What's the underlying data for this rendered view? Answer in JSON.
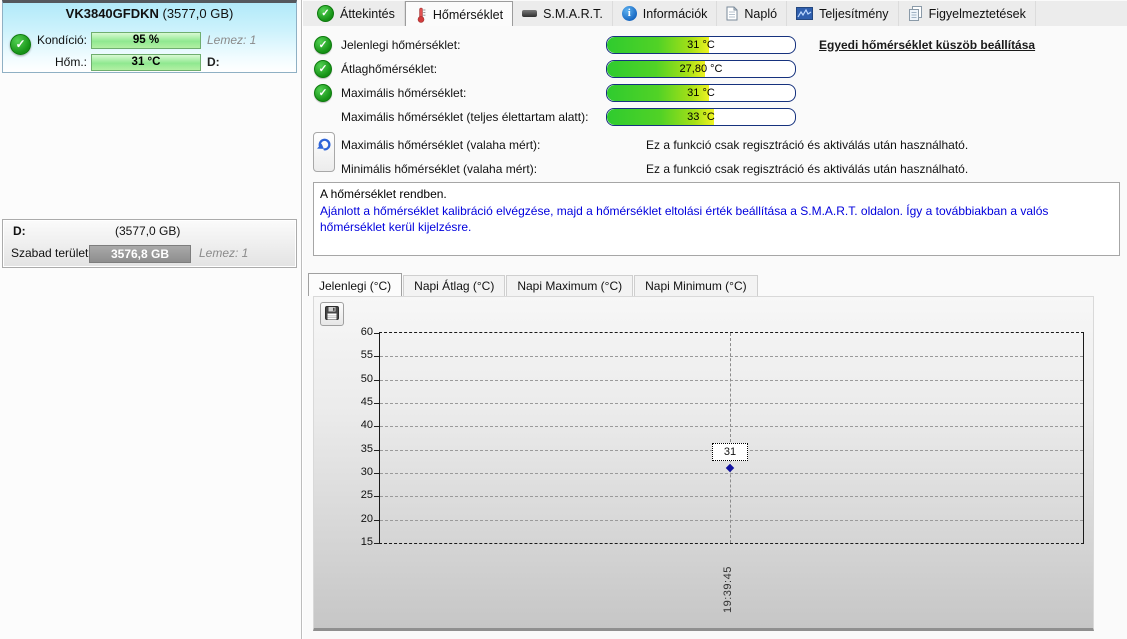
{
  "sidebar": {
    "drive": {
      "name": "VK3840GFDKN",
      "size": "(3577,0 GB)",
      "condition_label": "Kondíció:",
      "condition_value": "95 %",
      "lemez": "Lemez: 1",
      "temp_label": "Hőm.:",
      "temp_value": "31 °C",
      "letter": "D:",
      "status_icon": "green-check-circle"
    },
    "partition": {
      "name": "D:",
      "size": "(3577,0 GB)",
      "free_label": "Szabad terület",
      "free_value": "3576,8 GB",
      "lemez": "Lemez: 1"
    }
  },
  "tabs": [
    {
      "label": "Áttekintés",
      "icon": "green-check-icon"
    },
    {
      "label": "Hőmérséklet",
      "icon": "thermometer-icon",
      "active": true
    },
    {
      "label": "S.M.A.R.T.",
      "icon": "hard-disk-icon"
    },
    {
      "label": "Információk",
      "icon": "info-icon"
    },
    {
      "label": "Napló",
      "icon": "document-icon"
    },
    {
      "label": "Teljesítmény",
      "icon": "performance-chart-icon"
    },
    {
      "label": "Figyelmeztetések",
      "icon": "pages-icon"
    }
  ],
  "temperature": {
    "rows": [
      {
        "label": "Jelenlegi hőmérséklet:",
        "value": "31 °C",
        "fill": "width:54%",
        "status_icon": "green-check-circle"
      },
      {
        "label": "Átlaghőmérséklet:",
        "value": "27,80 °C",
        "fill": "width:52%",
        "status_icon": "green-check-circle"
      },
      {
        "label": "Maximális hőmérséklet:",
        "value": "31 °C",
        "fill": "width:54%",
        "status_icon": "green-check-circle"
      },
      {
        "label": "Maximális hőmérséklet (teljes élettartam alatt):",
        "value": "33 °C",
        "fill": "width:57%",
        "status_icon": "none"
      }
    ],
    "threshold_link": "Egyedi hőmérséklet küszöb beállítása",
    "locked": [
      {
        "label": "Maximális hőmérséklet (valaha mért):",
        "value": "Ez a funkció csak regisztráció és aktiválás után használható."
      },
      {
        "label": "Minimális hőmérséklet (valaha mért):",
        "value": "Ez a funkció csak regisztráció és aktiválás után használható."
      }
    ],
    "note_ok": "A hőmérséklet rendben.",
    "note_advice": "Ajánlott a hőmérséklet kalibráció elvégzése, majd a hőmérséklet eltolási érték beállítása a S.M.A.R.T. oldalon. Így a továbbiakban a valós hőmérséklet kerül kijelzésre."
  },
  "chart_tabs": [
    {
      "label": "Jelenlegi (°C)",
      "active": true
    },
    {
      "label": "Napi Átlag (°C)"
    },
    {
      "label": "Napi Maximum (°C)"
    },
    {
      "label": "Napi Minimum (°C)"
    }
  ],
  "chart_data": {
    "type": "line",
    "title": "Jelenlegi (°C)",
    "x": [
      "19:39:45"
    ],
    "series": [
      {
        "name": "Jelenlegi (°C)",
        "values": [
          31
        ]
      }
    ],
    "point_label": "31",
    "ylim": [
      15,
      60
    ],
    "yticks": [
      60,
      55,
      50,
      45,
      40,
      35,
      30,
      25,
      20,
      15
    ],
    "grid": "dashed horizontal gridlines, dashed vertical marker at sample",
    "legend_position": "none",
    "point_color": "#1313a0"
  },
  "icons": {
    "save_button": "floppy-disk-icon",
    "reset_button": "undo-arrow-icon"
  }
}
